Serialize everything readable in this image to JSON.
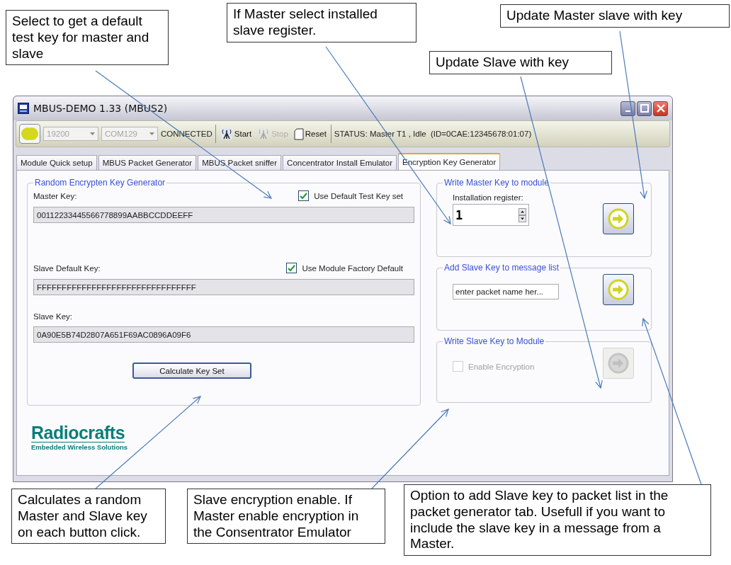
{
  "callouts": [
    {
      "text": "Select to get a default test key for master and slave"
    },
    {
      "text": "If Master select installed slave register."
    },
    {
      "text": "Update Master slave with key"
    },
    {
      "text": "Update Slave with key"
    },
    {
      "text": "Calculates a random Master and Slave key on each button click."
    },
    {
      "text": "Slave encryption enable. If Master enable encryption in the Consentrator Emulator"
    },
    {
      "text": "Option to add Slave key to packet list in the packet generator tab. Usefull if you want to include the slave key in a message from a Master."
    }
  ],
  "window": {
    "title": "MBUS-DEMO 1.33 (MBUS2)"
  },
  "toolbar": {
    "baud": {
      "value": "19200",
      "disabled": true
    },
    "port": {
      "value": "COM129",
      "disabled": true
    },
    "connection": "CONNECTED",
    "buttons": [
      {
        "kind": "start",
        "label": "Start",
        "disabled": false
      },
      {
        "kind": "stop",
        "label": "Stop",
        "disabled": true
      },
      {
        "kind": "reset",
        "label": "Reset",
        "disabled": false
      }
    ],
    "status": "STATUS: Master T1 , Idle  (ID=0CAE:12345678:01:07)"
  },
  "tabs": [
    {
      "label": "Module Quick setup",
      "selected": false
    },
    {
      "label": "MBUS Packet Generator",
      "selected": false
    },
    {
      "label": "MBUS Packet sniffer",
      "selected": false
    },
    {
      "label": "Concentrator Install Emulator",
      "selected": false
    },
    {
      "label": "Encryption Key Generator",
      "selected": true
    }
  ],
  "key_generator": {
    "title": "Random Encrypten Key Generator",
    "master_key": {
      "label": "Master Key:",
      "checkbox": "Use Default Test Key set",
      "checked": true,
      "value": "00112233445566778899AABBCCDDEEFF"
    },
    "slave_default_key": {
      "label": "Slave Default Key:",
      "checkbox": "Use Module Factory Default",
      "checked": true,
      "value": "FFFFFFFFFFFFFFFFFFFFFFFFFFFFFFFF"
    },
    "slave_key": {
      "label": "Slave Key:",
      "value": "0A90E5B74D2807A651F69AC0896A09F6"
    },
    "button": "Calculate Key Set"
  },
  "write_master": {
    "title": "Write Master Key to module",
    "label": "Installation register:",
    "value": "1",
    "disabled": false
  },
  "add_slave": {
    "title": "Add Slave Key to message list",
    "value": "enter packet name her...",
    "disabled": false
  },
  "write_slave": {
    "title": "Write Slave Key to Module",
    "checkbox": "Enable Encryption",
    "checked": false,
    "disabled": true
  },
  "logo": {
    "name": "Radiocrafts",
    "tagline": "Embedded Wireless Solutions"
  }
}
